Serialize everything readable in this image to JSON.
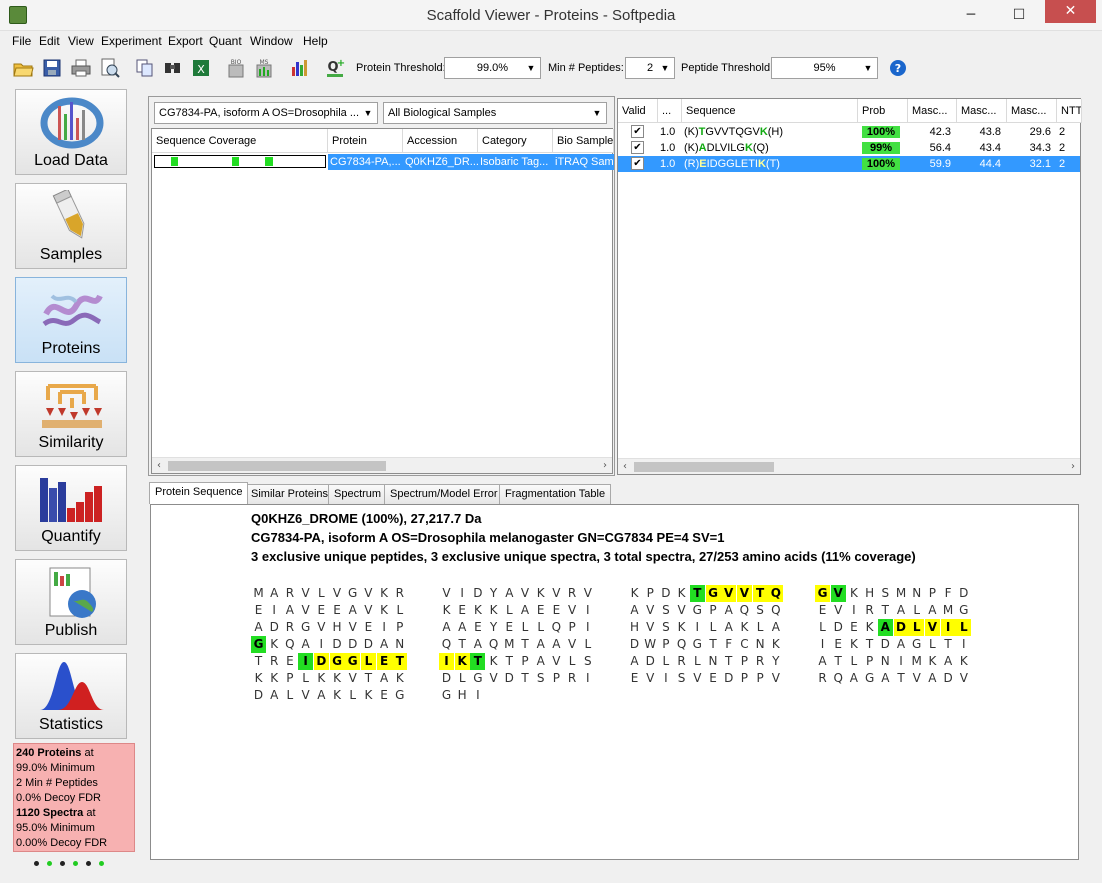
{
  "window": {
    "title": "Scaffold Viewer - Proteins - Softpedia",
    "minimize": "─",
    "maximize": "☐",
    "close": "✕"
  },
  "menu": [
    "File",
    "Edit",
    "View",
    "Experiment",
    "Export",
    "Quant",
    "Window",
    "Help"
  ],
  "toolbar": {
    "protein_threshold_label": "Protein Threshold:",
    "protein_threshold_value": "99.0%",
    "min_peptides_label": "Min # Peptides:",
    "min_peptides_value": "2",
    "peptide_threshold_label": "Peptide Threshold:",
    "peptide_threshold_value": "95%",
    "icons": [
      "open-icon",
      "save-icon",
      "print-icon",
      "print-preview-icon",
      "copy-icon",
      "find-icon",
      "export-excel-icon",
      "bio-export-icon",
      "ms-export-icon",
      "bar-chart-icon",
      "quant-add-icon",
      "help-icon"
    ]
  },
  "sidebar": {
    "items": [
      {
        "label": "Load Data",
        "icon": "load-data-icon"
      },
      {
        "label": "Samples",
        "icon": "samples-icon"
      },
      {
        "label": "Proteins",
        "icon": "proteins-icon"
      },
      {
        "label": "Similarity",
        "icon": "similarity-icon"
      },
      {
        "label": "Quantify",
        "icon": "quantify-icon"
      },
      {
        "label": "Publish",
        "icon": "publish-icon"
      },
      {
        "label": "Statistics",
        "icon": "statistics-icon"
      }
    ],
    "selected": "Proteins"
  },
  "summary": {
    "lines": [
      {
        "bold": "240 Proteins",
        "rest": " at"
      },
      {
        "bold": "",
        "rest": "99.0% Minimum"
      },
      {
        "bold": "",
        "rest": "2 Min # Peptides"
      },
      {
        "bold": "",
        "rest": "0.0% Decoy FDR"
      },
      {
        "bold": "1120 Spectra",
        "rest": " at"
      },
      {
        "bold": "",
        "rest": "95.0% Minimum"
      },
      {
        "bold": "",
        "rest": "0.00% Decoy FDR"
      }
    ],
    "dot_colors": [
      "#222222",
      "#22cc22",
      "#222222",
      "#22cc22",
      "#222222",
      "#22cc22"
    ]
  },
  "protein_panel": {
    "protein_select": "CG7834-PA, isoform A OS=Drosophila ...",
    "sample_select": "All Biological Samples",
    "columns": [
      "Sequence Coverage",
      "Protein",
      "Accession",
      "Category",
      "Bio Sample"
    ],
    "rows": [
      {
        "protein": "CG7834-PA,...",
        "accession": "Q0KHZ6_DR...",
        "category": "Isobaric Tag...",
        "bio_sample": "iTRAQ Samp"
      }
    ]
  },
  "peptide_panel": {
    "columns": [
      "Valid",
      "...",
      "Sequence",
      "Prob",
      "Masc...",
      "Masc...",
      "Masc...",
      "NTT"
    ],
    "rows": [
      {
        "valid": "✔",
        "mult": "1.0",
        "seq_pre": "(K)",
        "seq_first": "T",
        "seq_mid": "GVVTQGV",
        "seq_last": "K",
        "seq_post": "(H)",
        "prob": "100%",
        "m1": "42.3",
        "m2": "43.8",
        "m3": "29.6",
        "ntt": "2"
      },
      {
        "valid": "✔",
        "mult": "1.0",
        "seq_pre": "(K)",
        "seq_first": "A",
        "seq_mid": "DLVILG",
        "seq_last": "K",
        "seq_post": "(Q)",
        "prob": "99%",
        "m1": "56.4",
        "m2": "43.4",
        "m3": "34.3",
        "ntt": "2"
      },
      {
        "valid": "✔",
        "mult": "1.0",
        "seq_pre": "(R)",
        "seq_first": "E",
        "seq_mid": "IDGGLETI",
        "seq_last": "K",
        "seq_post": "(T)",
        "prob": "100%",
        "m1": "59.9",
        "m2": "44.4",
        "m3": "32.1",
        "ntt": "2"
      }
    ]
  },
  "tabs": [
    "Protein Sequence",
    "Similar Proteins",
    "Spectrum",
    "Spectrum/Model Error",
    "Fragmentation Table"
  ],
  "sequence_view": {
    "header1": "Q0KHZ6_DROME (100%), 27,217.7 Da",
    "header2": "CG7834-PA, isoform A OS=Drosophila melanogaster GN=CG7834 PE=4 SV=1",
    "header3": "3 exclusive unique peptides, 3 exclusive unique spectra, 3 total spectra, 27/253 amino acids (11% coverage)",
    "sequence": "MARVLVGVKRVIDYAVKVRVKPDKTGVVTQGVKHSMNPFDEIAVEEAVKLKEKKLAEEVIAVSVGPAQSQEVIRTALAMGADRGVHVEIPAAEYELLQPIHVSKILAKLALDEKADLVILGKQAIDDDANQTAQMTAAVLDWPQGTFCNKIEKTDAGLTITREIDGGLETIKTKTPAVLSADLRLNTPRYATLPNIMKAKKKPLKKVTAKDLGVDTSPRIEVISVEDPPVRQAGATVADVDALVAKLKEGGHI",
    "highlights": [
      {
        "start": 24,
        "end": 32
      },
      {
        "start": 114,
        "end": 121
      },
      {
        "start": 163,
        "end": 173
      }
    ]
  }
}
